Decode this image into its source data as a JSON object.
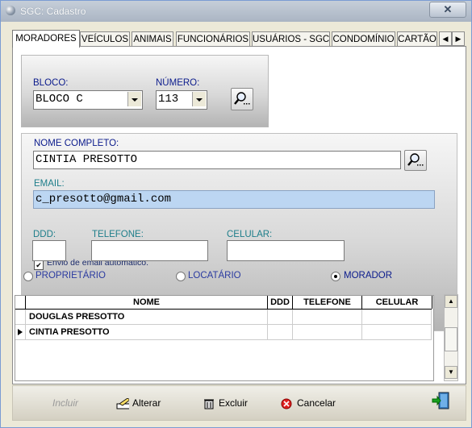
{
  "window": {
    "title": "SGC: Cadastro",
    "close": "✕"
  },
  "tabs": [
    "MORADORES",
    "VEÍCULOS",
    "ANIMAIS",
    "FUNCIONÁRIOS",
    "USUÁRIOS - SGC",
    "CONDOMÍNIO",
    "CARTÃO"
  ],
  "filter": {
    "bloco_label": "BLOCO:",
    "bloco_value": "BLOCO C",
    "numero_label": "NÚMERO:",
    "numero_value": "113"
  },
  "form": {
    "nome_label": "NOME COMPLETO:",
    "nome_value": "CINTIA PRESOTTO",
    "email_label": "EMAIL:",
    "email_value": "c_presotto@gmail.com",
    "email_auto_label": "Envio de email automático.",
    "ddd_label": "DDD:",
    "ddd_value": "",
    "telefone_label": "TELEFONE:",
    "telefone_value": "",
    "celular_label": "CELULAR:",
    "celular_value": "",
    "radio_proprietario": "PROPRIETÁRIO",
    "radio_locatario": "LOCATÁRIO",
    "radio_morador": "MORADOR",
    "selected_type": "MORADOR"
  },
  "grid": {
    "columns": [
      "NOME",
      "DDD",
      "TELEFONE",
      "CELULAR"
    ],
    "rows": [
      [
        "DOUGLAS PRESOTTO",
        "",
        "",
        ""
      ],
      [
        "CINTIA PRESOTTO",
        "",
        "",
        ""
      ]
    ]
  },
  "footer": {
    "incluir": "Incluir",
    "alterar": "Alterar",
    "excluir": "Excluir",
    "cancelar": "Cancelar"
  }
}
